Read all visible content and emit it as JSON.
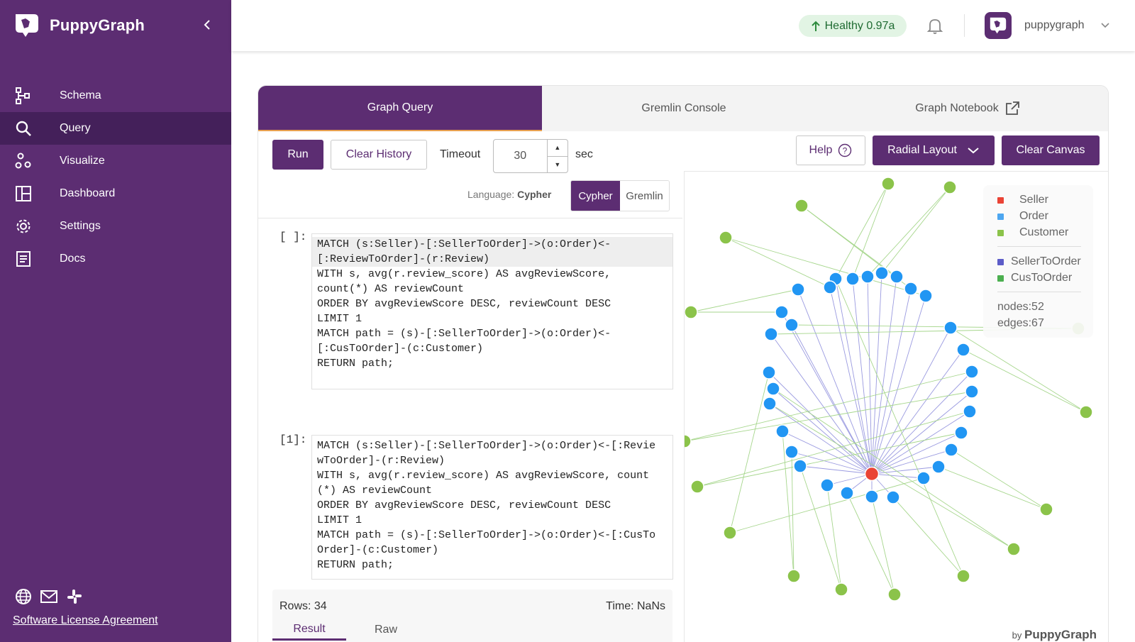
{
  "app": {
    "name": "PuppyGraph"
  },
  "sidebar": {
    "items": [
      {
        "label": "Schema",
        "icon": "schema-icon"
      },
      {
        "label": "Query",
        "icon": "search-icon",
        "active": true
      },
      {
        "label": "Visualize",
        "icon": "visualize-icon"
      },
      {
        "label": "Dashboard",
        "icon": "dashboard-icon"
      },
      {
        "label": "Settings",
        "icon": "gear-icon"
      },
      {
        "label": "Docs",
        "icon": "docs-icon"
      }
    ],
    "footer_icons": [
      "globe-icon",
      "mail-icon",
      "slack-icon"
    ],
    "license_link": "Software License Agreement"
  },
  "header": {
    "status": "Healthy 0.97a",
    "username": "puppygraph"
  },
  "tabs": [
    "Graph Query",
    "Gremlin Console",
    "Graph Notebook"
  ],
  "toolbar": {
    "run": "Run",
    "clear_history": "Clear History",
    "timeout_label": "Timeout",
    "timeout_value": "30",
    "timeout_unit": "sec",
    "help": "Help",
    "layout": "Radial Layout",
    "clear_canvas": "Clear Canvas"
  },
  "language": {
    "label": "Language:",
    "current": "Cypher",
    "options": [
      "Cypher",
      "Gremlin"
    ]
  },
  "cells": [
    {
      "prompt": "[ ]:",
      "lines": [
        "MATCH (s:Seller)-[:SellerToOrder]->(o:Order)<-",
        "[:ReviewToOrder]-(r:Review)",
        "WITH s, avg(r.review_score) AS avgReviewScore,",
        "count(*) AS reviewCount",
        "ORDER BY avgReviewScore DESC, reviewCount DESC",
        "LIMIT 1",
        "MATCH path = (s)-[:SellerToOrder]->(o:Order)<-",
        "[:CusToOrder]-(c:Customer)",
        "RETURN path;"
      ]
    },
    {
      "prompt": "[1]:",
      "lines": [
        "MATCH (s:Seller)-[:SellerToOrder]->(o:Order)<-[:Revie",
        "wToOrder]-(r:Review)",
        "WITH s, avg(r.review_score) AS avgReviewScore, count",
        "(*) AS reviewCount",
        "ORDER BY avgReviewScore DESC, reviewCount DESC",
        "LIMIT 1",
        "MATCH path = (s)-[:SellerToOrder]->(o:Order)<-[:CusTo",
        "Order]-(c:Customer)",
        "RETURN path;"
      ]
    }
  ],
  "result": {
    "rows": "Rows: 34",
    "time": "Time: NaNs",
    "tabs": [
      "Result",
      "Raw"
    ]
  },
  "legend": {
    "nodes": [
      {
        "label": "Seller",
        "color": "#ea4335"
      },
      {
        "label": "Order",
        "color": "#4da6f0"
      },
      {
        "label": "Customer",
        "color": "#8bc34a"
      }
    ],
    "edges": [
      {
        "label": "SellerToOrder",
        "color": "#5c5cc8"
      },
      {
        "label": "CusToOrder",
        "color": "#4caf50"
      }
    ],
    "nodes_count": "nodes:52",
    "edges_count": "edges:67"
  },
  "byline": {
    "prefix": "by",
    "brand": "PuppyGraph"
  },
  "colors": {
    "brand": "#5c2d72",
    "seller": "#ea4335",
    "order": "#2196f3",
    "customer": "#8bc34a"
  }
}
